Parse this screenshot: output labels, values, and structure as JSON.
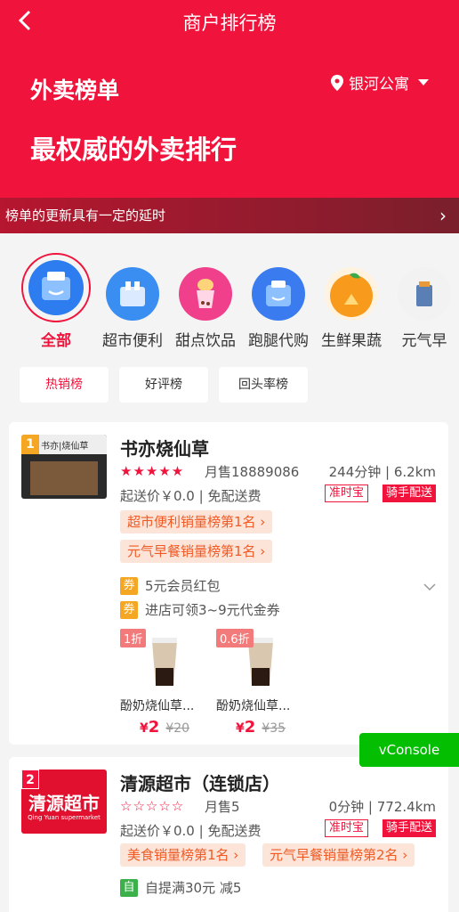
{
  "nav": {
    "back_icon": "chevron-left-icon",
    "title": "商户排行榜"
  },
  "header": {
    "title": "外卖榜单",
    "slogan": "最权威的外卖排行",
    "location": "银河公寓"
  },
  "notice": {
    "text": "榜单的更新具有一定的延时"
  },
  "categories": [
    {
      "label": "全部",
      "active": true,
      "color": "#2d7cf0"
    },
    {
      "label": "超市便利",
      "active": false,
      "color": "#3a8ef2"
    },
    {
      "label": "甜点饮品",
      "active": false,
      "color": "#f0408c"
    },
    {
      "label": "跑腿代购",
      "active": false,
      "color": "#3a7cf0"
    },
    {
      "label": "生鲜果蔬",
      "active": false,
      "color": "#f89a1c"
    },
    {
      "label": "元气早",
      "active": false,
      "color": "#e8e8e8"
    }
  ],
  "rank_tabs": [
    {
      "label": "热销榜",
      "active": true
    },
    {
      "label": "好评榜",
      "active": false
    },
    {
      "label": "回头率榜",
      "active": false
    }
  ],
  "shops": [
    {
      "rank": "1",
      "rank_color": "#f5a623",
      "name": "书亦烧仙草",
      "thumb_text": "书亦|烧仙草",
      "stars": "★★★★★",
      "sales": "月售18889086",
      "distance": "244分钟 | 6.2km",
      "min_fee": "起送价￥0.0 | 免配送费",
      "tag_ontime": "准时宝",
      "tag_rider": "骑手配送",
      "rank_badges": [
        "超市便利销量榜第1名 ›",
        "元气早餐销量榜第1名 ›"
      ],
      "promos": [
        {
          "icon": "券",
          "color": "#f5a623",
          "text": "5元会员红包"
        },
        {
          "icon": "券",
          "color": "#f5a623",
          "text": "进店可领3~9元代金券"
        }
      ],
      "products": [
        {
          "discount": "1折",
          "name": "酚奶烧仙草...",
          "price_symbol": "¥",
          "price": "2",
          "old_price": "¥20"
        },
        {
          "discount": "0.6折",
          "name": "酚奶烧仙草...",
          "price_symbol": "¥",
          "price": "2",
          "old_price": "¥35"
        }
      ]
    },
    {
      "rank": "2",
      "rank_color": "#f0143c",
      "name": "清源超市（连锁店）",
      "thumb_text": "清源超市",
      "thumb_sub": "Qing Yuan supermarket",
      "stars": "☆☆☆☆☆",
      "sales": "月售5",
      "distance": "0分钟 | 772.4km",
      "min_fee": "起送价￥0.0 | 免配送费",
      "tag_ontime": "准时宝",
      "tag_rider": "骑手配送",
      "rank_badges": [
        "美食销量榜第1名 ›",
        "元气早餐销量榜第2名 ›"
      ],
      "promos": [
        {
          "icon": "自",
          "color": "#3cb04a",
          "text": "自提满30元 减5"
        }
      ]
    }
  ],
  "vconsole": {
    "label": "vConsole"
  }
}
